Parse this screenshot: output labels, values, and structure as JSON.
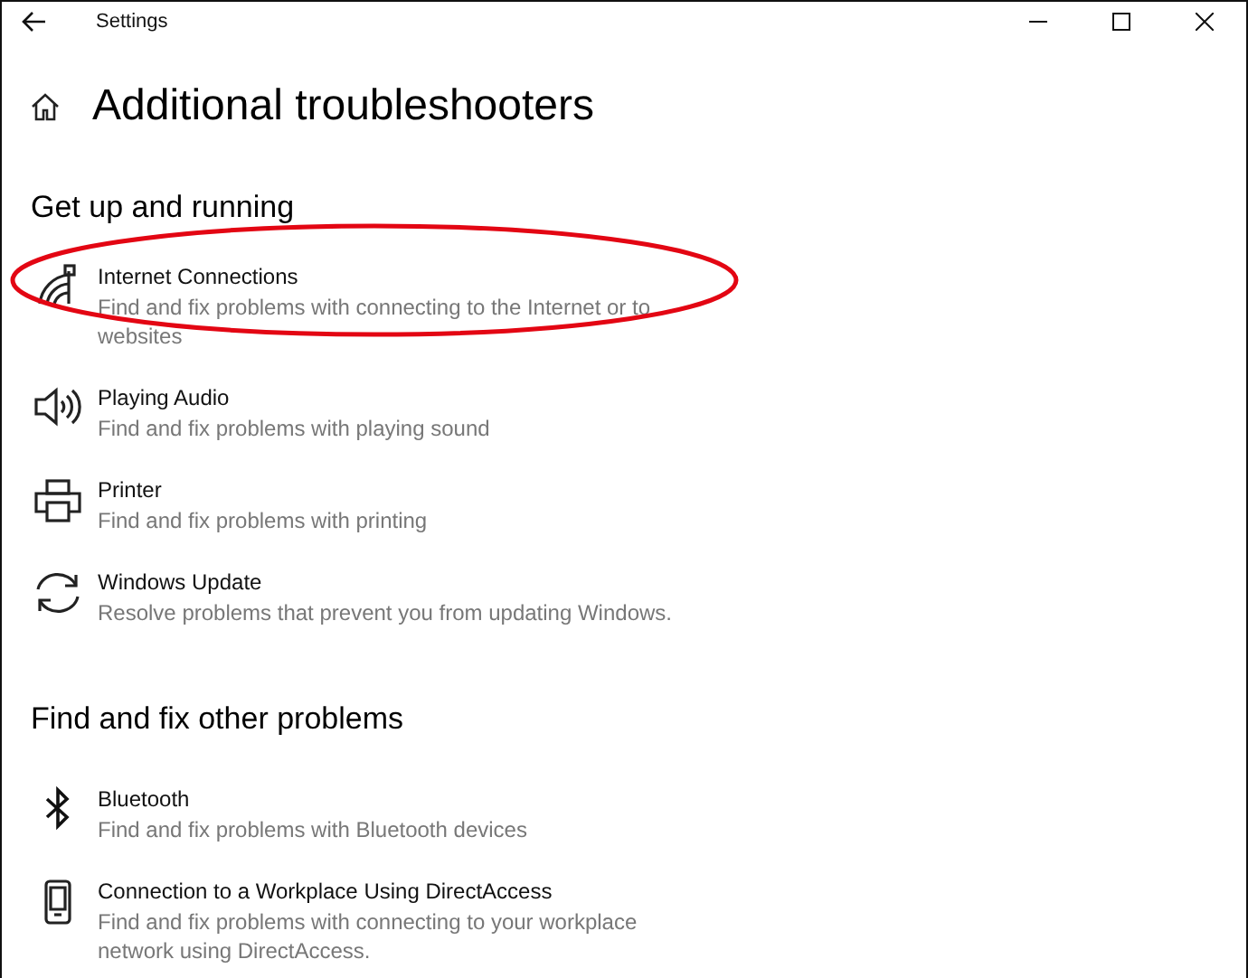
{
  "window": {
    "title": "Settings"
  },
  "page_title": "Additional troubleshooters",
  "sections": [
    {
      "heading": "Get up and running",
      "items": [
        {
          "kind": "wifi",
          "title": "Internet Connections",
          "description": "Find and fix problems with connecting to the Internet or to websites",
          "highlighted": true
        },
        {
          "kind": "speaker",
          "title": "Playing Audio",
          "description": "Find and fix problems with playing sound",
          "highlighted": false
        },
        {
          "kind": "printer",
          "title": "Printer",
          "description": "Find and fix problems with printing",
          "highlighted": false
        },
        {
          "kind": "update",
          "title": "Windows Update",
          "description": "Resolve problems that prevent you from updating Windows.",
          "highlighted": false
        }
      ]
    },
    {
      "heading": "Find and fix other problems",
      "items": [
        {
          "kind": "bluetooth",
          "title": "Bluetooth",
          "description": "Find and fix problems with Bluetooth devices",
          "highlighted": false
        },
        {
          "kind": "phone",
          "title": "Connection to a Workplace Using DirectAccess",
          "description": "Find and fix problems with connecting to your workplace network using DirectAccess.",
          "highlighted": false
        }
      ]
    }
  ]
}
